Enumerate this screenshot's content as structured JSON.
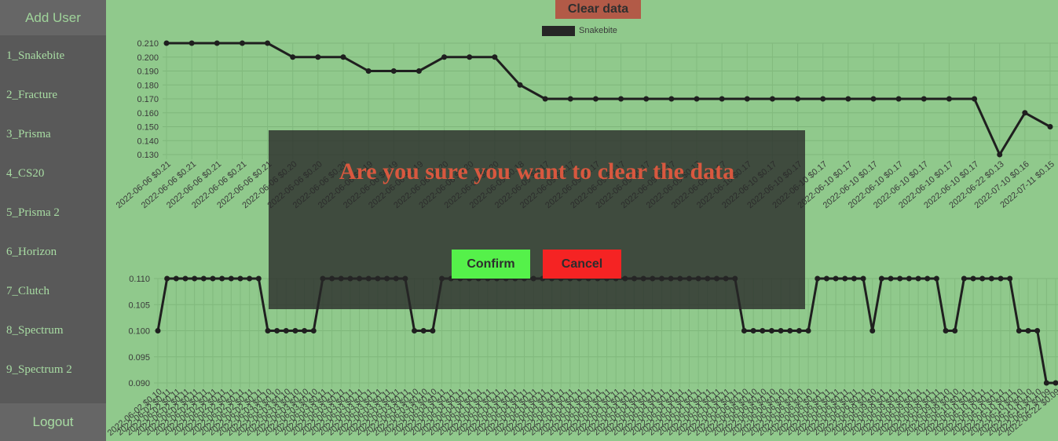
{
  "sidebar": {
    "add_user": "Add User",
    "items": [
      {
        "label": "1_Snakebite"
      },
      {
        "label": "2_Fracture"
      },
      {
        "label": "3_Prisma"
      },
      {
        "label": "4_CS20"
      },
      {
        "label": "5_Prisma 2"
      },
      {
        "label": "6_Horizon"
      },
      {
        "label": "7_Clutch"
      },
      {
        "label": "8_Spectrum"
      },
      {
        "label": "9_Spectrum 2"
      }
    ],
    "logout": "Logout"
  },
  "toolbar": {
    "clear_data": "Clear data"
  },
  "legend": {
    "label": "Snakebite",
    "color": "#262626"
  },
  "modal": {
    "title": "Are you sure you want to clear the data",
    "confirm": "Confirm",
    "cancel": "Cancel",
    "confirm_color": "#55f14a",
    "cancel_color": "#f52323"
  },
  "colors": {
    "background": "#90c98c",
    "sidebar": "#595959",
    "line": "#1f1f1f",
    "clear_button": "#b25a47"
  },
  "chart_data": [
    {
      "type": "line",
      "series": [
        {
          "name": "Snakebite"
        }
      ],
      "ylim": [
        0.13,
        0.21
      ],
      "yticks": [
        "0.210",
        "0.200",
        "0.190",
        "0.180",
        "0.170",
        "0.160",
        "0.150",
        "0.140",
        "0.130"
      ],
      "x": [
        "2022-06-06 $0.21",
        "2022-06-06 $0.21",
        "2022-06-06 $0.21",
        "2022-06-06 $0.21",
        "2022-06-06 $0.21",
        "2022-06-06 $0.20",
        "2022-06-06 $0.20",
        "2022-06-06 $0.20",
        "2022-06-06 $0.19",
        "2022-06-06 $0.19",
        "2022-06-06 $0.19",
        "2022-06-06 $0.20",
        "2022-06-06 $0.20",
        "2022-06-09 $0.20",
        "2022-06-09 $0.18",
        "2022-06-09 $0.17",
        "2022-06-09 $0.17",
        "2022-06-09 $0.17",
        "2022-06-09 $0.17",
        "2022-06-09 $0.17",
        "2022-06-09 $0.17",
        "2022-06-09 $0.17",
        "2022-06-09 $0.17",
        "2022-06-10 $0.17",
        "2022-06-10 $0.17",
        "2022-06-10 $0.17",
        "2022-06-10 $0.17",
        "2022-06-10 $0.17",
        "2022-06-10 $0.17",
        "2022-06-10 $0.17",
        "2022-06-10 $0.17",
        "2022-06-10 $0.17",
        "2022-06-10 $0.17",
        "2022-06-22 $0.13",
        "2022-07-10 $0.16",
        "2022-07-11 $0.15"
      ],
      "values": [
        0.21,
        0.21,
        0.21,
        0.21,
        0.21,
        0.2,
        0.2,
        0.2,
        0.19,
        0.19,
        0.19,
        0.2,
        0.2,
        0.2,
        0.18,
        0.17,
        0.17,
        0.17,
        0.17,
        0.17,
        0.17,
        0.17,
        0.17,
        0.17,
        0.17,
        0.17,
        0.17,
        0.17,
        0.17,
        0.17,
        0.17,
        0.17,
        0.17,
        0.13,
        0.16,
        0.15
      ]
    },
    {
      "type": "line",
      "ylim": [
        0.09,
        0.11
      ],
      "yticks": [
        "0.110",
        "0.105",
        "0.100",
        "0.095",
        "0.090"
      ],
      "x": [
        "2022-06-02 $0.10",
        "2022-06-02 $0.11",
        "2022-06-02 $0.11",
        "2022-06-02 $0.11",
        "2022-06-02 $0.11",
        "2022-06-02 $0.11",
        "2022-06-02 $0.11",
        "2022-06-02 $0.11",
        "2022-06-02 $0.11",
        "2022-06-02 $0.11",
        "2022-06-02 $0.11",
        "2022-06-02 $0.11",
        "2022-06-03 $0.10",
        "2022-06-03 $0.10",
        "2022-06-03 $0.10",
        "2022-06-03 $0.10",
        "2022-06-03 $0.10",
        "2022-06-03 $0.10",
        "2022-06-03 $0.11",
        "2022-06-03 $0.11",
        "2022-06-03 $0.11",
        "2022-06-03 $0.11",
        "2022-06-03 $0.11",
        "2022-06-03 $0.11",
        "2022-06-03 $0.11",
        "2022-06-03 $0.11",
        "2022-06-03 $0.11",
        "2022-06-03 $0.11",
        "2022-06-03 $0.10",
        "2022-06-03 $0.10",
        "2022-06-03 $0.10",
        "2022-06-04 $0.11",
        "2022-06-04 $0.11",
        "2022-06-04 $0.11",
        "2022-06-04 $0.11",
        "2022-06-04 $0.11",
        "2022-06-04 $0.11",
        "2022-06-04 $0.11",
        "2022-06-04 $0.11",
        "2022-06-04 $0.11",
        "2022-06-04 $0.11",
        "2022-06-04 $0.11",
        "2022-06-04 $0.11",
        "2022-06-04 $0.11",
        "2022-06-04 $0.11",
        "2022-06-04 $0.11",
        "2022-06-04 $0.11",
        "2022-06-04 $0.11",
        "2022-06-04 $0.11",
        "2022-06-04 $0.11",
        "2022-06-04 $0.11",
        "2022-06-04 $0.11",
        "2022-06-04 $0.11",
        "2022-06-04 $0.11",
        "2022-06-04 $0.11",
        "2022-06-04 $0.11",
        "2022-06-04 $0.11",
        "2022-06-04 $0.11",
        "2022-06-04 $0.11",
        "2022-06-04 $0.11",
        "2022-06-04 $0.11",
        "2022-06-04 $0.11",
        "2022-06-04 $0.11",
        "2022-06-04 $0.11",
        "2022-06-06 $0.10",
        "2022-06-06 $0.10",
        "2022-06-06 $0.10",
        "2022-06-06 $0.10",
        "2022-06-06 $0.10",
        "2022-06-06 $0.10",
        "2022-06-06 $0.10",
        "2022-06-06 $0.10",
        "2022-06-06 $0.11",
        "2022-06-06 $0.11",
        "2022-06-06 $0.11",
        "2022-06-06 $0.11",
        "2022-06-06 $0.11",
        "2022-06-06 $0.11",
        "2022-06-09 $0.10",
        "2022-06-09 $0.11",
        "2022-06-09 $0.11",
        "2022-06-09 $0.11",
        "2022-06-09 $0.11",
        "2022-06-09 $0.11",
        "2022-06-09 $0.11",
        "2022-06-09 $0.11",
        "2022-06-09 $0.10",
        "2022-06-09 $0.10",
        "2022-06-10 $0.11",
        "2022-06-10 $0.11",
        "2022-06-10 $0.11",
        "2022-06-10 $0.11",
        "2022-06-10 $0.11",
        "2022-06-10 $0.11",
        "2022-06-10 $0.10",
        "2022-06-10 $0.10",
        "2022-06-10 $0.10",
        "2022-06-22 $0.09",
        "2022-06-22 $0.09"
      ],
      "values": [
        0.1,
        0.11,
        0.11,
        0.11,
        0.11,
        0.11,
        0.11,
        0.11,
        0.11,
        0.11,
        0.11,
        0.11,
        0.1,
        0.1,
        0.1,
        0.1,
        0.1,
        0.1,
        0.11,
        0.11,
        0.11,
        0.11,
        0.11,
        0.11,
        0.11,
        0.11,
        0.11,
        0.11,
        0.1,
        0.1,
        0.1,
        0.11,
        0.11,
        0.11,
        0.11,
        0.11,
        0.11,
        0.11,
        0.11,
        0.11,
        0.11,
        0.11,
        0.11,
        0.11,
        0.11,
        0.11,
        0.11,
        0.11,
        0.11,
        0.11,
        0.11,
        0.11,
        0.11,
        0.11,
        0.11,
        0.11,
        0.11,
        0.11,
        0.11,
        0.11,
        0.11,
        0.11,
        0.11,
        0.11,
        0.1,
        0.1,
        0.1,
        0.1,
        0.1,
        0.1,
        0.1,
        0.1,
        0.11,
        0.11,
        0.11,
        0.11,
        0.11,
        0.11,
        0.1,
        0.11,
        0.11,
        0.11,
        0.11,
        0.11,
        0.11,
        0.11,
        0.1,
        0.1,
        0.11,
        0.11,
        0.11,
        0.11,
        0.11,
        0.11,
        0.1,
        0.1,
        0.1,
        0.09,
        0.09
      ]
    }
  ]
}
